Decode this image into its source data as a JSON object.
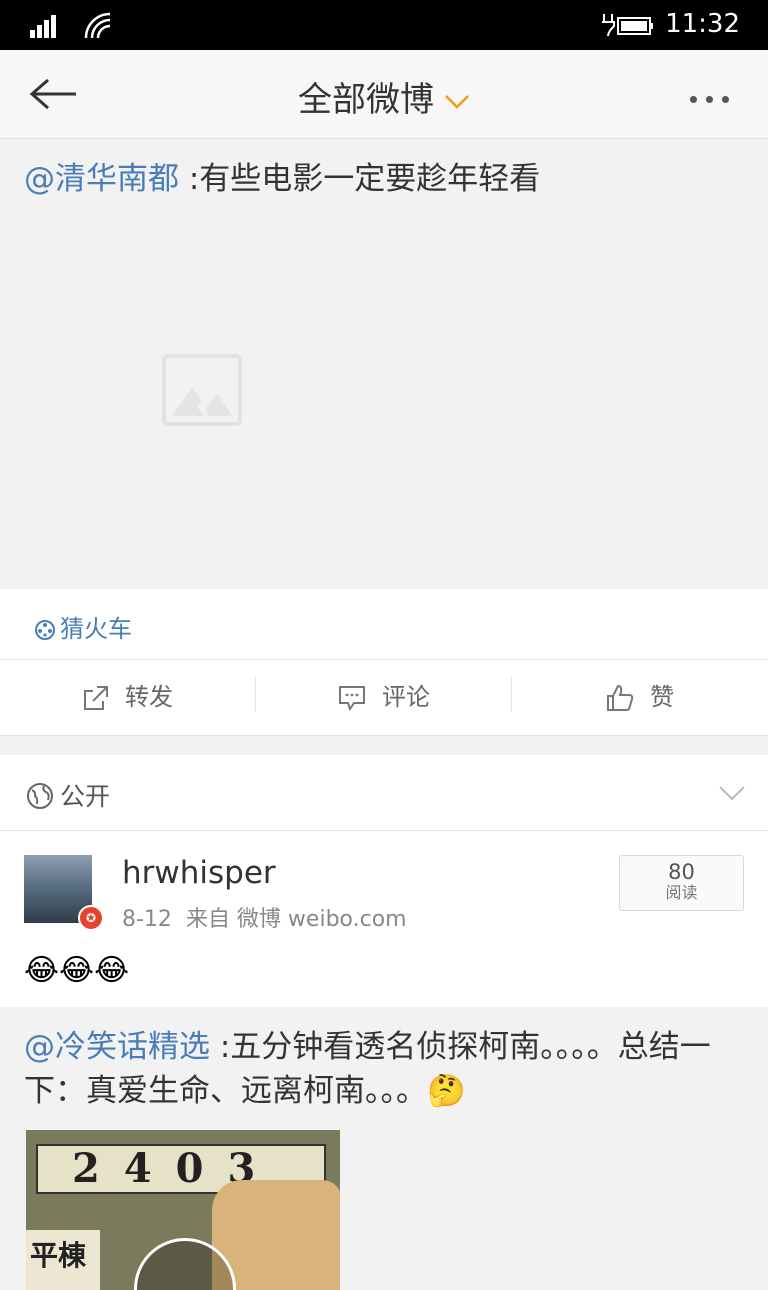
{
  "status_bar": {
    "time": "11:32"
  },
  "header": {
    "title": "全部微博"
  },
  "post1": {
    "mention": "@清华南都",
    "text": " :有些电影一定要趁年轻看",
    "topic": "猜火车",
    "actions": {
      "repost": "转发",
      "comment": "评论",
      "like": "赞"
    }
  },
  "post2": {
    "visibility": "公开",
    "username": "hrwhisper",
    "date": "8-12",
    "source": "来自 微博 weibo.com",
    "reads_count": "80",
    "reads_label": "阅读",
    "emojis": "😂😂😂",
    "repost_mention": "@冷笑话精选",
    "repost_text": " :五分钟看透名侦探柯南。。。。总结一下：真爱生命、远离柯南。。。🤔",
    "video_plate": "2403",
    "video_sign": "平棟"
  },
  "colors": {
    "accent_orange": "#f39c12",
    "link_blue": "#4a7db8"
  }
}
